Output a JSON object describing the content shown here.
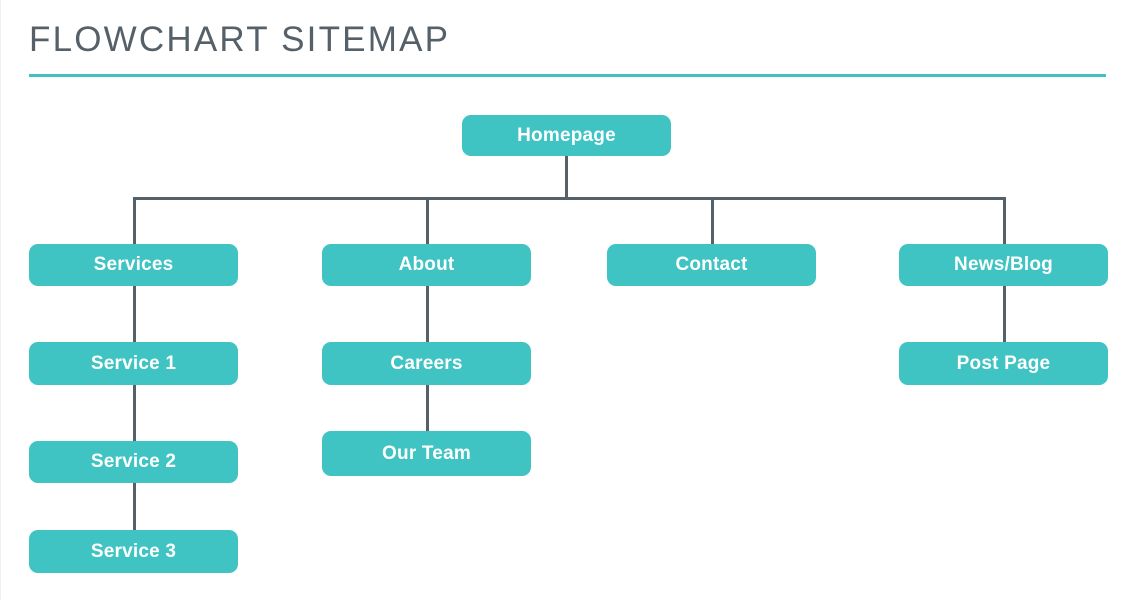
{
  "header": {
    "title": "FLOWCHART SITEMAP",
    "rule_color": "#3EC2C2"
  },
  "theme": {
    "node_fill": "#3FC3C3",
    "node_text": "#FFFFFF",
    "connector_color": "#566069",
    "title_color": "#566069",
    "background": "#FFFFFF"
  },
  "diagram": {
    "type": "sitemap-tree",
    "root": {
      "id": "homepage",
      "label": "Homepage"
    },
    "branches": [
      {
        "id": "services",
        "label": "Services",
        "children": [
          {
            "id": "service-1",
            "label": "Service 1"
          },
          {
            "id": "service-2",
            "label": "Service 2"
          },
          {
            "id": "service-3",
            "label": "Service 3"
          }
        ]
      },
      {
        "id": "about",
        "label": "About",
        "children": [
          {
            "id": "careers",
            "label": "Careers"
          },
          {
            "id": "our-team",
            "label": "Our Team"
          }
        ]
      },
      {
        "id": "contact",
        "label": "Contact",
        "children": []
      },
      {
        "id": "news-blog",
        "label": "News/Blog",
        "children": [
          {
            "id": "post-page",
            "label": "Post Page"
          }
        ]
      }
    ]
  },
  "nodes": {
    "homepage": "Homepage",
    "services": "Services",
    "service_1": "Service 1",
    "service_2": "Service 2",
    "service_3": "Service 3",
    "about": "About",
    "careers": "Careers",
    "our_team": "Our Team",
    "contact": "Contact",
    "news_blog": "News/Blog",
    "post_page": "Post Page"
  }
}
